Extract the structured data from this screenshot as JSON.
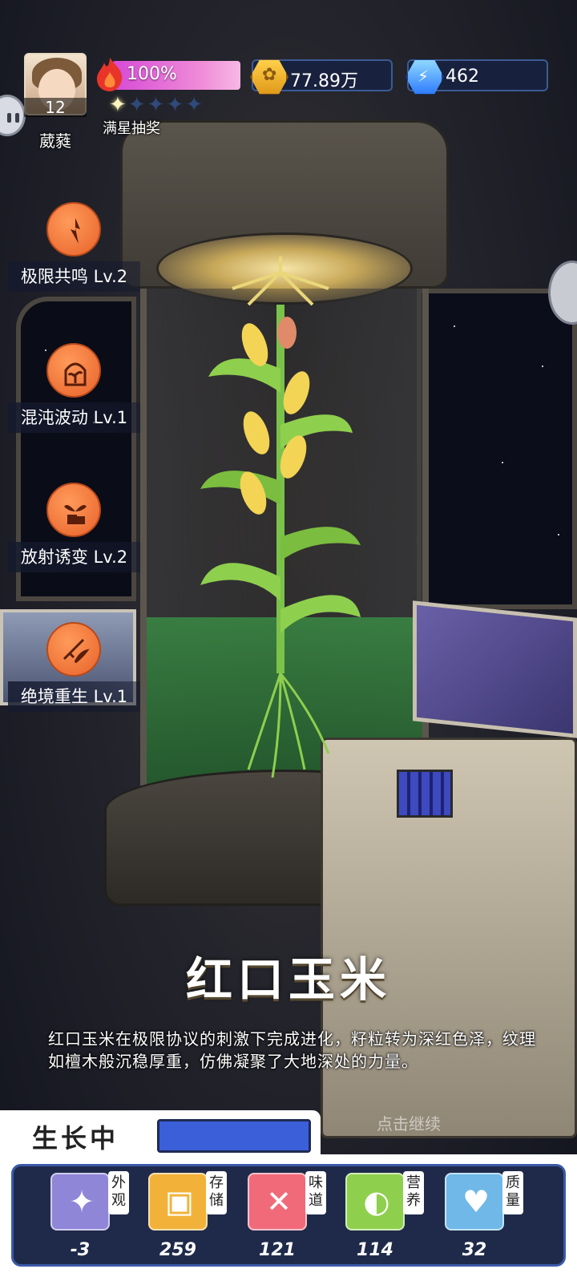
{
  "player": {
    "level": "12",
    "name": "葳蕤"
  },
  "energy": {
    "percent_text": "100%",
    "stars_filled": 1,
    "stars_total": 5,
    "star_label": "满星抽奖"
  },
  "currencies": {
    "coins": "77.89万",
    "gems": "462"
  },
  "skills": [
    {
      "label": "极限共鸣 Lv.2",
      "icon": "resonance-icon"
    },
    {
      "label": "混沌波动 Lv.1",
      "icon": "chaos-terrarium-icon"
    },
    {
      "label": "放射诱变 Lv.2",
      "icon": "radiation-sprout-icon"
    },
    {
      "label": "绝境重生 Lv.1",
      "icon": "rebirth-icon"
    }
  ],
  "crop": {
    "title": "红口玉米",
    "description": "红口玉米在极限协议的刺激下完成进化，籽粒转为深红色泽，纹理如檀木般沉稳厚重，仿佛凝聚了大地深处的力量。",
    "continue_hint": "点击继续"
  },
  "status": {
    "label": "生长中",
    "progress": 1.0
  },
  "stats": [
    {
      "tag": "外观",
      "value": "-3",
      "icon": "sparkle-icon",
      "color": "#8f86d8"
    },
    {
      "tag": "存储",
      "value": "259",
      "icon": "box-icon",
      "color": "#f2b23a"
    },
    {
      "tag": "味道",
      "value": "121",
      "icon": "utensils-icon",
      "color": "#f06a7a"
    },
    {
      "tag": "营养",
      "value": "114",
      "icon": "lemon-icon",
      "color": "#8fcf4e"
    },
    {
      "tag": "质量",
      "value": "32",
      "icon": "muscle-icon",
      "color": "#6fb8e8"
    }
  ]
}
